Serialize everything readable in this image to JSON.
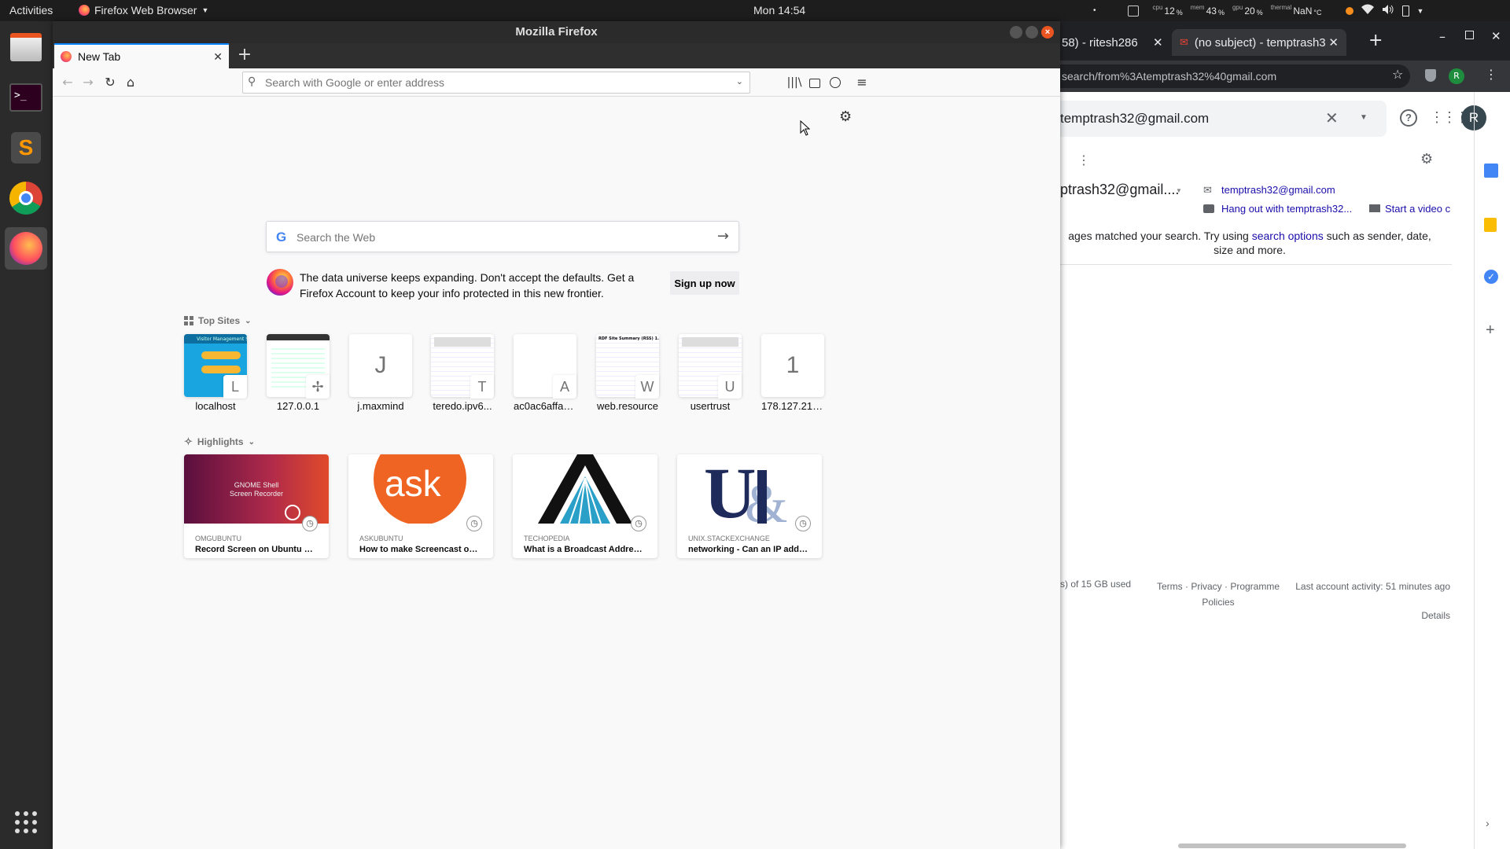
{
  "topbar": {
    "activities": "Activities",
    "app_menu": "Firefox Web Browser",
    "clock": "Mon 14:54",
    "cpu_label": "cpu",
    "cpu_value": "12",
    "mem_label": "mem",
    "mem_value": "43",
    "gpu_label": "gpu",
    "gpu_value": "20",
    "thermal_label": "thermal",
    "thermal_value": "NaN",
    "percent_unit": "%",
    "thermal_unit": "°C"
  },
  "dock": {
    "items": [
      "files-icon",
      "terminal-icon",
      "sublime-text-icon",
      "chrome-icon",
      "firefox-icon"
    ],
    "show_apps": "apps-grid-icon"
  },
  "firefox": {
    "window_title": "Mozilla Firefox",
    "tab_title": "New Tab",
    "url_placeholder": "Search with Google or enter address",
    "web_search_placeholder": "Search the Web",
    "promo_text": "The data universe keeps expanding. Don't accept the defaults. Get a Firefox Account to keep your info protected in this new frontier.",
    "signup_label": "Sign up now",
    "top_sites_title": "Top Sites",
    "highlights_title": "Highlights",
    "top_sites": [
      {
        "label": "localhost",
        "letter": "L",
        "thumb_text": "Visitor Management S"
      },
      {
        "label": "127.0.0.1",
        "letter": ""
      },
      {
        "label": "j.maxmind",
        "letter": "J"
      },
      {
        "label": "teredo.ipv6...",
        "letter": "T"
      },
      {
        "label": "ac0ac6affa4...",
        "letter": "A"
      },
      {
        "label": "web.resource",
        "letter": "W",
        "thumb_text": "RDF Site Summary (RSS) 1.0"
      },
      {
        "label": "usertrust",
        "letter": "U"
      },
      {
        "label": "178.127.215...",
        "letter": "1"
      }
    ],
    "highlights": [
      {
        "source": "OMGUBUNTU",
        "title": "Record Screen on Ubuntu Using ...",
        "thumb_text": "GNOME Shell Screen Recorder"
      },
      {
        "source": "ASKUBUNTU",
        "title": "How to make Screencast on Ub...",
        "thumb_text": "ask"
      },
      {
        "source": "TECHOPEDIA",
        "title": "What is a Broadcast Address? - ..."
      },
      {
        "source": "UNIX.STACKEXCHANGE",
        "title": "networking - Can an IP address ..."
      }
    ]
  },
  "chrome": {
    "tab1_title": "58) - ritesh286",
    "tab2_title": "(no subject) - temptrash3",
    "url": "search/from%3Atemptrash32%40gmail.com",
    "search_query": "temptrash32@gmail.com",
    "contact_name": "ptrash32@gmail....",
    "contact_email": "temptrash32@gmail.com",
    "hangout": "Hang out with temptrash32...",
    "video": "Start a video c",
    "no_match_text": "ages matched your search. Try using ",
    "search_options": "search options",
    "no_match_rest": " such as sender, date, size and more.",
    "storage": "s) of 15 GB used",
    "footer_terms": "Terms · Privacy · Programme Policies",
    "last_activity": "Last account activity: 51 minutes ago",
    "details": "Details",
    "avatar_letter": "R"
  }
}
